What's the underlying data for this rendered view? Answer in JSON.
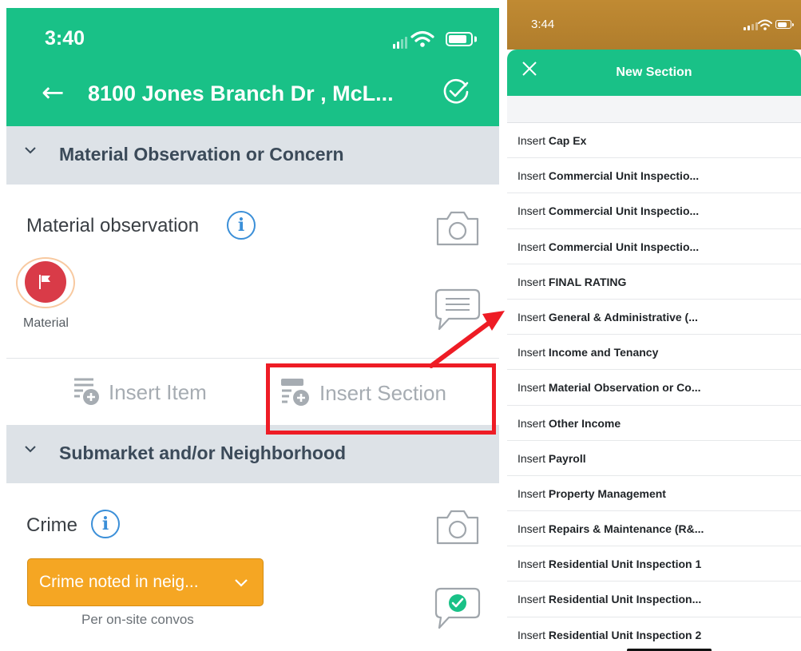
{
  "left": {
    "status": {
      "time": "3:40"
    },
    "nav": {
      "title": "8100 Jones Branch Dr , McL...",
      "back_icon": "arrow-left-icon",
      "check_icon": "check-circle-icon"
    },
    "section1": {
      "title": "Material Observation or Concern"
    },
    "material_item": {
      "label": "Material observation",
      "flag_caption": "Material",
      "flag_color": "#d93b48"
    },
    "actions": {
      "insert_item": "Insert Item",
      "insert_section": "Insert Section"
    },
    "section2": {
      "title": "Submarket and/or Neighborhood"
    },
    "crime_item": {
      "label": "Crime",
      "selected": "Crime noted in neig...",
      "note": "Per on-site convos",
      "select_color": "#f5a623"
    }
  },
  "right": {
    "status": {
      "time": "3:44"
    },
    "nav": {
      "title": "New Section",
      "close_icon": "close-icon"
    },
    "items": [
      {
        "prefix": "Insert",
        "name": "Cap Ex"
      },
      {
        "prefix": "Insert",
        "name": "Commercial Unit Inspectio..."
      },
      {
        "prefix": "Insert",
        "name": "Commercial Unit Inspectio..."
      },
      {
        "prefix": "Insert",
        "name": "Commercial Unit Inspectio..."
      },
      {
        "prefix": "Insert",
        "name": "FINAL RATING"
      },
      {
        "prefix": "Insert",
        "name": "General & Administrative (..."
      },
      {
        "prefix": "Insert",
        "name": "Income and Tenancy"
      },
      {
        "prefix": "Insert",
        "name": "Material Observation or Co..."
      },
      {
        "prefix": "Insert",
        "name": "Other Income"
      },
      {
        "prefix": "Insert",
        "name": "Payroll"
      },
      {
        "prefix": "Insert",
        "name": "Property Management"
      },
      {
        "prefix": "Insert",
        "name": "Repairs & Maintenance (R&..."
      },
      {
        "prefix": "Insert",
        "name": "Residential Unit Inspection 1"
      },
      {
        "prefix": "Insert",
        "name": "Residential Unit Inspection..."
      },
      {
        "prefix": "Insert",
        "name": "Residential Unit Inspection 2"
      }
    ]
  },
  "colors": {
    "brand_green": "#19c187",
    "annotation_red": "#ee1c25",
    "section_bg": "#dde2e7"
  }
}
